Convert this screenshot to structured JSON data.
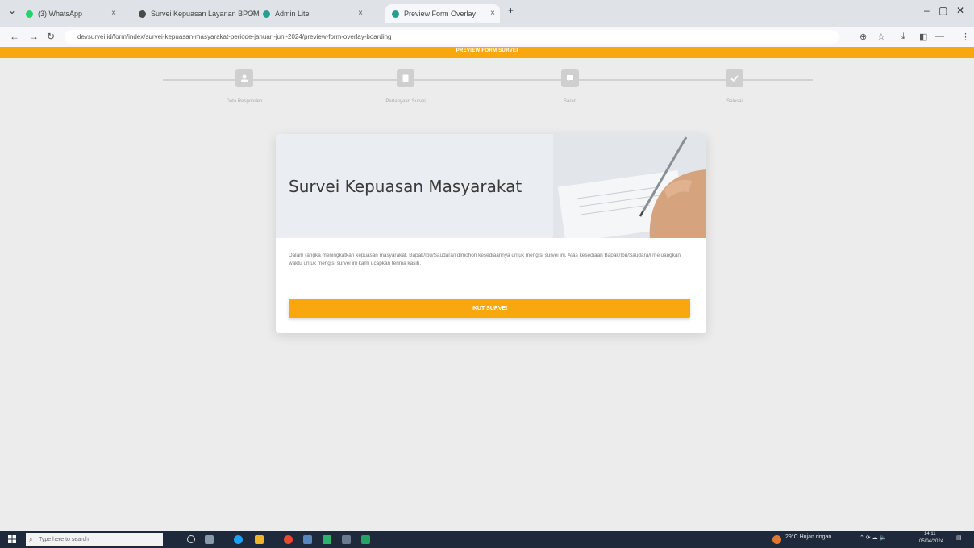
{
  "browser": {
    "tabs": [
      {
        "label": "(3) WhatsApp",
        "active": false,
        "fav_color": "#25d366"
      },
      {
        "label": "Survei Kepuasan Layanan BPOM",
        "active": false,
        "fav_color": "#4a4a4a"
      },
      {
        "label": "Admin Lite",
        "active": false,
        "fav_color": "#2a9d8f"
      },
      {
        "label": "Preview Form Overlay",
        "active": true,
        "fav_color": "#2a9d8f"
      }
    ],
    "new_tab": "+",
    "url": "devsurvei.id/form/index/survei-kepuasan-masyarakat-periode-januari-juni-2024/preview-form-overlay-boarding"
  },
  "page": {
    "banner": "PREVIEW FORM SURVEI",
    "steps": [
      {
        "label": "Data Responden",
        "icon": "user-icon"
      },
      {
        "label": "Pertanyaan Survei",
        "icon": "document-icon"
      },
      {
        "label": "Saran",
        "icon": "comment-icon"
      },
      {
        "label": "Selesai",
        "icon": "check-icon"
      }
    ],
    "card": {
      "title": "Survei Kepuasan Masyarakat",
      "description": "Dalam rangka meningkatkan kepuasan masyarakat, Bapak/Ibu/Saudara/i dimohon kesediaannya untuk mengisi survei ini. Atas kesediaan Bapak/Ibu/Saudara/i meluangkan waktu untuk mengisi survei ini kami ucapkan terima kasih.",
      "button": "IKUT SURVEI"
    }
  },
  "taskbar": {
    "search_placeholder": "Type here to search",
    "weather": "29°C  Hujan ringan",
    "time": "14:11",
    "date": "05/04/2024"
  },
  "colors": {
    "accent": "#f9a70f",
    "step_gray": "#cfcfcf"
  }
}
